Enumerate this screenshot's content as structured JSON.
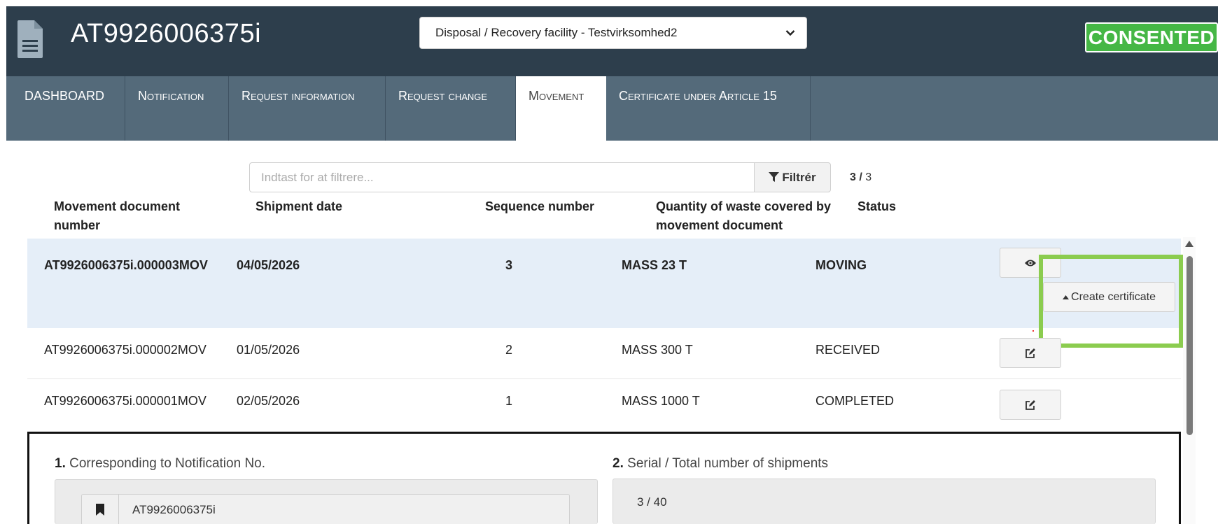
{
  "header": {
    "title": "AT9926006375i",
    "facility_select": "Disposal / Recovery facility - Testvirksomhed2",
    "status": "CONSENTED",
    "status_color": "#45b745"
  },
  "tabs": [
    {
      "label": "DASHBOARD"
    },
    {
      "label": "Notification"
    },
    {
      "label": "Request information"
    },
    {
      "label": "Request change"
    },
    {
      "label": "Movement"
    },
    {
      "label": "Certificate under Article 15"
    }
  ],
  "filter": {
    "placeholder": "Indtast for at filtrere...",
    "button_label": "Filtrér",
    "page_current": "3 /",
    "page_total": "3"
  },
  "table": {
    "columns": [
      "Movement document number",
      "Shipment date",
      "Sequence number",
      "Quantity of waste covered by movement document",
      "Status"
    ],
    "rows": [
      {
        "doc": "AT9926006375i.000003MOV",
        "date": "04/05/2026",
        "seq": "3",
        "qty": "MASS 23 T",
        "status": "MOVING"
      },
      {
        "doc": "AT9926006375i.000002MOV",
        "date": "01/05/2026",
        "seq": "2",
        "qty": "MASS 300 T",
        "status": "RECEIVED"
      },
      {
        "doc": "AT9926006375i.000001MOV",
        "date": "02/05/2026",
        "seq": "1",
        "qty": "MASS 1000 T",
        "status": "COMPLETED"
      }
    ],
    "create_certificate_label": "Create certificate"
  },
  "detail": {
    "field1_num": "1.",
    "field1_label": "Corresponding to Notification No.",
    "field1_value": "AT9926006375i",
    "field2_num": "2.",
    "field2_label": "Serial / Total number of shipments",
    "field2_value": "3 / 40"
  }
}
